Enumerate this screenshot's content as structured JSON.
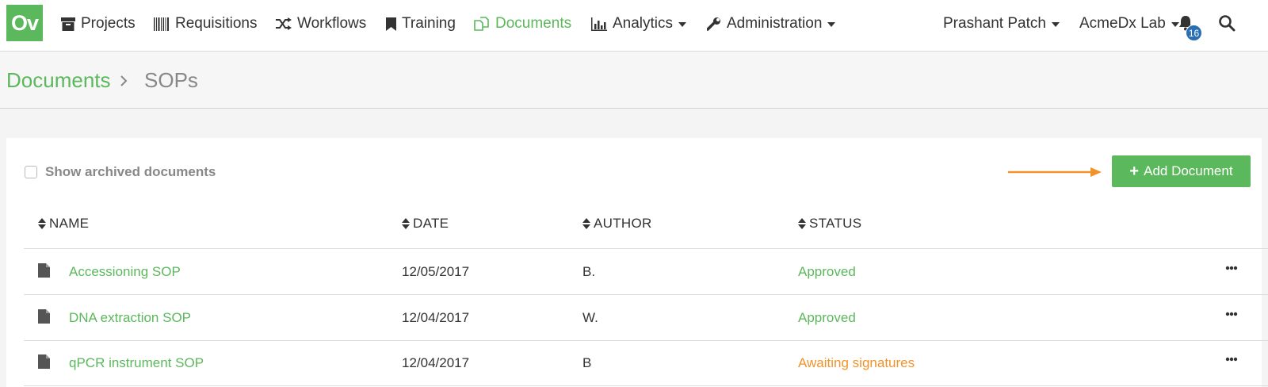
{
  "nav": {
    "logo": "Ov",
    "items": [
      {
        "label": "Projects",
        "icon": "archive-icon"
      },
      {
        "label": "Requisitions",
        "icon": "barcode-icon"
      },
      {
        "label": "Workflows",
        "icon": "shuffle-icon"
      },
      {
        "label": "Training",
        "icon": "bookmark-icon"
      },
      {
        "label": "Documents",
        "icon": "files-icon",
        "active": true
      },
      {
        "label": "Analytics",
        "icon": "bar-chart-icon",
        "dropdown": true
      },
      {
        "label": "Administration",
        "icon": "wrench-icon",
        "dropdown": true
      }
    ],
    "user": "Prashant Patch",
    "lab": "AcmeDx Lab",
    "notification_count": "16"
  },
  "breadcrumb": {
    "root": "Documents",
    "current": "SOPs"
  },
  "toolbar": {
    "archived_label": "Show archived documents",
    "add_label": "Add Document"
  },
  "table": {
    "columns": [
      "NAME",
      "DATE",
      "AUTHOR",
      "STATUS"
    ],
    "rows": [
      {
        "name": "Accessioning SOP",
        "date": "12/05/2017",
        "author": "B.",
        "status": "Approved",
        "status_type": "approved"
      },
      {
        "name": "DNA extraction SOP",
        "date": "12/04/2017",
        "author": "W.",
        "status": "Approved",
        "status_type": "approved"
      },
      {
        "name": "qPCR instrument SOP",
        "date": "12/04/2017",
        "author": "B",
        "status": "Awaiting signatures",
        "status_type": "awaiting"
      }
    ]
  },
  "colors": {
    "brand_green": "#5cb85c",
    "awaiting_orange": "#f0932b",
    "badge_blue": "#2a6fb3",
    "annotation_arrow": "#f0932b"
  }
}
